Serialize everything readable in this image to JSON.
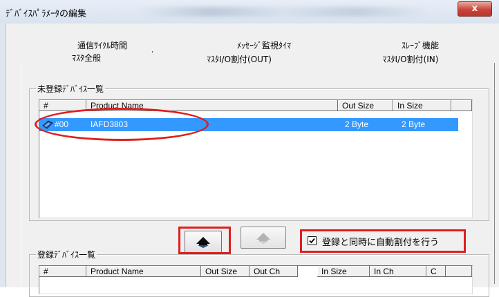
{
  "window": {
    "title": "ﾃﾞﾊﾞｲｽﾊﾟﾗﾒｰﾀの編集",
    "close_label": "x"
  },
  "tabs": {
    "row1": [
      "通信ｻｲｸﾙ時間",
      "ﾒｯｾｰｼﾞ監視ﾀｲﾏ",
      "ｽﾚｰﾌﾞ機能"
    ],
    "row2": [
      "ﾏｽﾀ全般",
      "ﾏｽﾀI/O割付(OUT)",
      "ﾏｽﾀI/O割付(IN)"
    ],
    "active": "ﾏｽﾀ全般"
  },
  "unregistered": {
    "label": "未登録ﾃﾞﾊﾞｲｽ一覧",
    "columns": [
      "#",
      "Product Name",
      "Out Size",
      "In Size"
    ],
    "rows": [
      {
        "num": "#00",
        "product": "IAFD3803",
        "out_size": "2 Byte",
        "in_size": "2 Byte",
        "selected": true
      }
    ]
  },
  "actions": {
    "register_button_icon": "arrow-down-icon",
    "unregister_button_icon": "arrow-up-icon",
    "auto_assign_checkbox": {
      "label": "登録と同時に自動割付を行う",
      "checked": true
    }
  },
  "registered": {
    "label": "登録ﾃﾞﾊﾞｲｽ一覧",
    "columns": [
      "#",
      "Product Name",
      "Out Size",
      "Out Ch",
      "In Size",
      "In Ch",
      "C"
    ]
  },
  "colors": {
    "selection": "#3399ff",
    "highlight": "#e01e1e"
  }
}
